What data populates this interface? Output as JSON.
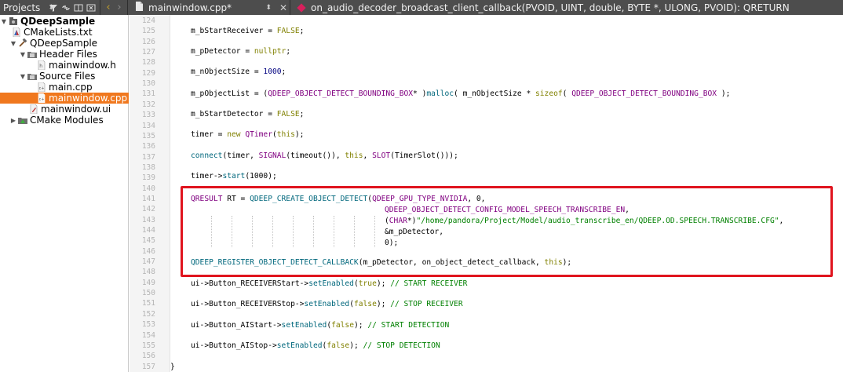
{
  "topbar": {
    "projects_label": "Projects",
    "file_tab_label": "mainwindow.cpp*",
    "function_label": "on_audio_decoder_broadcast_client_callback(PVOID, UINT, double, BYTE *, ULONG, PVOID): QRETURN"
  },
  "tree": {
    "root": "QDeepSample",
    "cmakelists": "CMakeLists.txt",
    "target": "QDeepSample",
    "header_files": "Header Files",
    "mainwindow_h": "mainwindow.h",
    "source_files": "Source Files",
    "main_cpp": "main.cpp",
    "mainwindow_cpp": "mainwindow.cpp",
    "mainwindow_ui": "mainwindow.ui",
    "cmake_modules": "CMake Modules"
  },
  "editor": {
    "line_numbers": [
      "124",
      "125",
      "126",
      "127",
      "128",
      "129",
      "130",
      "131",
      "132",
      "133",
      "134",
      "135",
      "136",
      "137",
      "138",
      "139",
      "140",
      "141",
      "142",
      "143",
      "144",
      "145",
      "146",
      "147",
      "148",
      "149",
      "150",
      "151",
      "152",
      "153",
      "154",
      "155",
      "156",
      "157"
    ],
    "code": {
      "l125": {
        "var": "m_bStartReceiver",
        "op": " = ",
        "val": "FALSE",
        "end": ";"
      },
      "l127": {
        "var": "m_pDetector",
        "op": " = ",
        "val": "nullptr",
        "end": ";"
      },
      "l129": {
        "var": "m_nObjectSize",
        "op": " = ",
        "val": "1000",
        "end": ";"
      },
      "l131": {
        "a": "m_pObjectList = (",
        "b": "QDEEP_OBJECT_DETECT_BOUNDING_BOX",
        "c": "* )",
        "d": "malloc",
        "e": "( m_nObjectSize * ",
        "f": "sizeof",
        "g": "( ",
        "h": "QDEEP_OBJECT_DETECT_BOUNDING_BOX",
        "i": " );"
      },
      "l133": {
        "var": "m_bStartDetector",
        "op": " = ",
        "val": "FALSE",
        "end": ";"
      },
      "l135": {
        "a": "timer = ",
        "b": "new",
        "c": " ",
        "d": "QTimer",
        "e": "(",
        "f": "this",
        "g": ");"
      },
      "l137": {
        "a": "connect",
        "b": "(timer, ",
        "c": "SIGNAL",
        "d": "(timeout()), ",
        "e": "this",
        "f": ", ",
        "g": "SLOT",
        "h": "(TimerSlot()));"
      },
      "l139": {
        "a": "timer->",
        "b": "start",
        "c": "(1000);"
      },
      "l141": {
        "a": "QRESULT",
        "b": " RT = ",
        "c": "QDEEP_CREATE_OBJECT_DETECT",
        "d": "(",
        "e": "QDEEP_GPU_TYPE_NVIDIA",
        "f": ", 0,"
      },
      "l142": {
        "a": "QDEEP_OBJECT_DETECT_CONFIG_MODEL_SPEECH_TRANSCRIBE_EN",
        "b": ","
      },
      "l143": {
        "a": "(",
        "b": "CHAR",
        "c": "*)",
        "d": "\"/home/pandora/Project/Model/audio_transcribe_en/QDEEP.OD.SPEECH.TRANSCRIBE.CFG\"",
        "e": ","
      },
      "l144": {
        "a": "&m_pDetector,"
      },
      "l145": {
        "a": "0);"
      },
      "l147": {
        "a": "QDEEP_REGISTER_OBJECT_DETECT_CALLBACK",
        "b": "(m_pDetector, on_object_detect_callback, ",
        "c": "this",
        "d": ");"
      },
      "l149": {
        "a": "ui->",
        "b": "Button_RECEIVERStart",
        "c": "->",
        "d": "setEnabled",
        "e": "(",
        "f": "true",
        "g": "); ",
        "h": "// START RECEIVER"
      },
      "l151": {
        "a": "ui->",
        "b": "Button_RECEIVERStop",
        "c": "->",
        "d": "setEnabled",
        "e": "(",
        "f": "false",
        "g": "); ",
        "h": "// STOP RECEIVER"
      },
      "l153": {
        "a": "ui->",
        "b": "Button_AIStart",
        "c": "->",
        "d": "setEnabled",
        "e": "(",
        "f": "false",
        "g": "); ",
        "h": "// START DETECTION"
      },
      "l155": {
        "a": "ui->",
        "b": "Button_AIStop",
        "c": "->",
        "d": "setEnabled",
        "e": "(",
        "f": "false",
        "g": "); ",
        "h": "// STOP DETECTION"
      },
      "l157": {
        "a": "}"
      }
    }
  },
  "icons": {
    "filter": "filter-icon",
    "link": "link-icon",
    "split": "split-icon",
    "close_panel": "close-panel-icon",
    "back": "back-arrow-icon",
    "forward": "forward-arrow-icon"
  },
  "colors": {
    "selection": "#f0781e",
    "highlight_box": "#e0141e",
    "keyword": "#808000",
    "type": "#800080",
    "string": "#008000",
    "function": "#00677c"
  }
}
